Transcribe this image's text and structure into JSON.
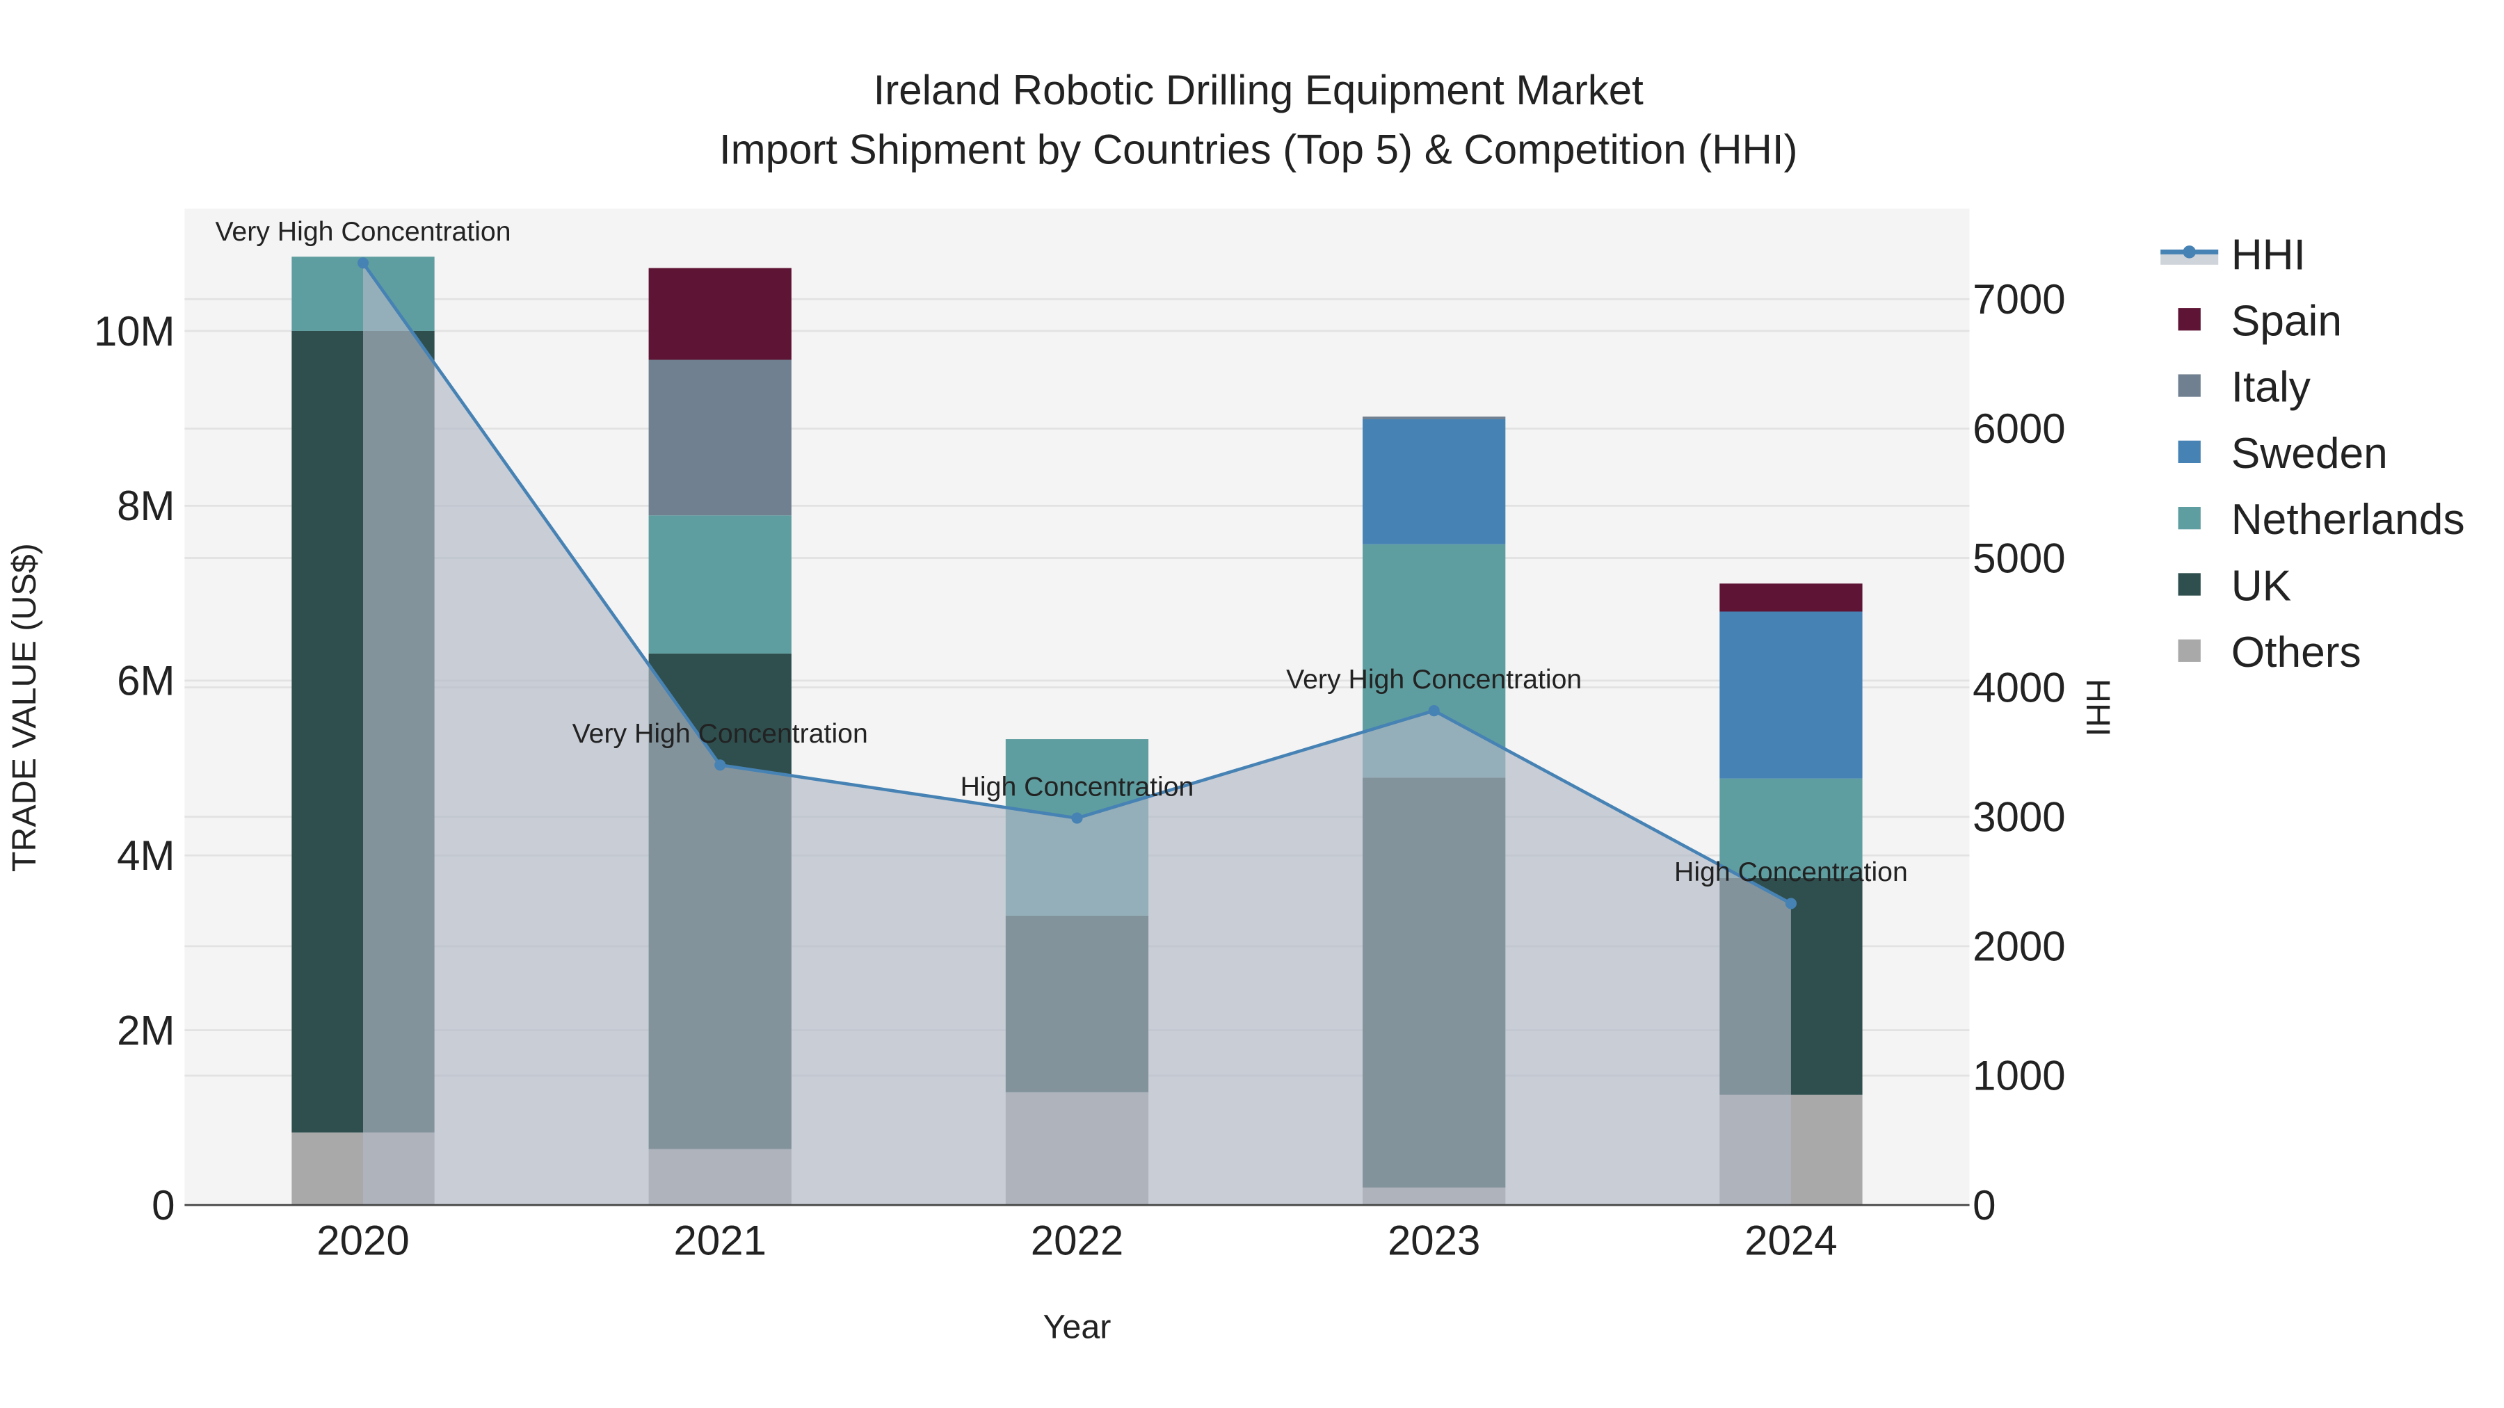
{
  "chart_data": {
    "type": "bar",
    "barmode": "stack",
    "title": "Ireland Robotic Drilling Equipment Market",
    "subtitle": "Import Shipment by Countries (Top 5) & Competition (HHI)",
    "xlabel": "Year",
    "ylabel": "TRADE VALUE (US$)",
    "y2label": "HHI",
    "categories": [
      "2020",
      "2021",
      "2022",
      "2023",
      "2024"
    ],
    "ylim": [
      0,
      11400000
    ],
    "y2lim": [
      0,
      7700
    ],
    "yticks": [
      0,
      2000000,
      4000000,
      6000000,
      8000000,
      10000000
    ],
    "ytick_labels": [
      "0",
      "2M",
      "4M",
      "6M",
      "8M",
      "10M"
    ],
    "y2ticks": [
      0,
      1000,
      2000,
      3000,
      4000,
      5000,
      6000,
      7000
    ],
    "y2tick_labels": [
      "0",
      "1000",
      "2000",
      "3000",
      "4000",
      "5000",
      "6000",
      "7000"
    ],
    "grid": true,
    "legend_position": "right",
    "series": [
      {
        "name": "Others",
        "color": "#a9a9a9",
        "values": [
          830000,
          640000,
          1290000,
          200000,
          1260000
        ]
      },
      {
        "name": "UK",
        "color": "#2f4f4f",
        "values": [
          9170000,
          5670000,
          2020000,
          4690000,
          2480000
        ]
      },
      {
        "name": "Netherlands",
        "color": "#5f9ea0",
        "values": [
          850000,
          1580000,
          2020000,
          2670000,
          1140000
        ]
      },
      {
        "name": "Sweden",
        "color": "#4682b4",
        "values": [
          0,
          0,
          0,
          1430000,
          1910000
        ]
      },
      {
        "name": "Italy",
        "color": "#708090",
        "values": [
          0,
          1780000,
          0,
          30000,
          0
        ]
      },
      {
        "name": "Spain",
        "color": "#5e1535",
        "values": [
          0,
          1050000,
          0,
          0,
          320000
        ]
      }
    ],
    "hhi": {
      "name": "HHI",
      "color": "#4682b4",
      "fill": "rgba(176,184,198,0.65)",
      "values": [
        7280,
        3400,
        2990,
        3820,
        2330
      ],
      "annotations": [
        "Very High Concentration",
        "Very High Concentration",
        "High Concentration",
        "Very High Concentration",
        "High Concentration"
      ]
    },
    "legend": [
      "HHI",
      "Spain",
      "Italy",
      "Sweden",
      "Netherlands",
      "UK",
      "Others"
    ]
  }
}
